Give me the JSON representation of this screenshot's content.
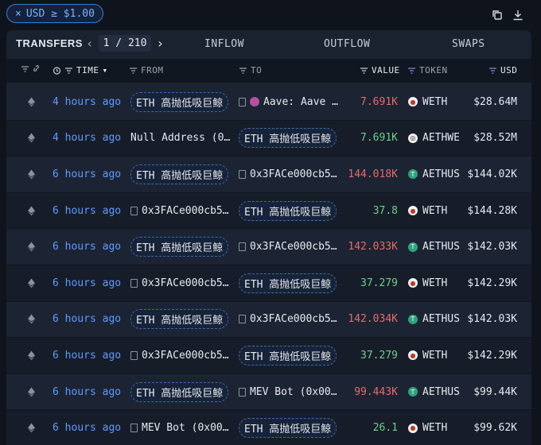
{
  "filter_chip": {
    "close": "×",
    "label": "USD ≥ $1.00"
  },
  "tabs": {
    "active": "TRANSFERS",
    "page": "1 / 210",
    "items": [
      "INFLOW",
      "OUTFLOW",
      "SWAPS"
    ]
  },
  "columns": {
    "time": "TIME",
    "from": "FROM",
    "to": "TO",
    "value": "VALUE",
    "token": "TOKEN",
    "usd": "USD"
  },
  "colors": {
    "accent": "#5f9bff",
    "negative": "#e86a6a",
    "positive": "#6fcf8a",
    "background": "#0f141c"
  },
  "rows": [
    {
      "time": "4 hours ago",
      "from": "ETH 高抛低吸巨鲸",
      "from_kind": "pill",
      "to": "Aave: Aave …",
      "to_kind": "aave",
      "value": "7.691K",
      "value_sign": "neg",
      "token": "WETH",
      "token_kind": "weth",
      "usd": "$28.64M"
    },
    {
      "time": "4 hours ago",
      "from": "Null Address (0…",
      "from_kind": "text",
      "to": "ETH 高抛低吸巨鲸",
      "to_kind": "pill",
      "value": "7.691K",
      "value_sign": "pos",
      "token": "AETHWE",
      "token_kind": "aethwe",
      "usd": "$28.52M"
    },
    {
      "time": "6 hours ago",
      "from": "ETH 高抛低吸巨鲸",
      "from_kind": "pill",
      "to": "0x3FACe000cb5…",
      "to_kind": "doc",
      "value": "144.018K",
      "value_sign": "neg",
      "token": "AETHUS",
      "token_kind": "aethus",
      "usd": "$144.02K"
    },
    {
      "time": "6 hours ago",
      "from": "0x3FACe000cb5…",
      "from_kind": "doc",
      "to": "ETH 高抛低吸巨鲸",
      "to_kind": "pill",
      "value": "37.8",
      "value_sign": "pos",
      "token": "WETH",
      "token_kind": "weth",
      "usd": "$144.28K"
    },
    {
      "time": "6 hours ago",
      "from": "ETH 高抛低吸巨鲸",
      "from_kind": "pill",
      "to": "0x3FACe000cb5…",
      "to_kind": "doc",
      "value": "142.033K",
      "value_sign": "neg",
      "token": "AETHUS",
      "token_kind": "aethus",
      "usd": "$142.03K"
    },
    {
      "time": "6 hours ago",
      "from": "0x3FACe000cb5…",
      "from_kind": "doc",
      "to": "ETH 高抛低吸巨鲸",
      "to_kind": "pill",
      "value": "37.279",
      "value_sign": "pos",
      "token": "WETH",
      "token_kind": "weth",
      "usd": "$142.29K"
    },
    {
      "time": "6 hours ago",
      "from": "ETH 高抛低吸巨鲸",
      "from_kind": "pill",
      "to": "0x3FACe000cb5…",
      "to_kind": "doc",
      "value": "142.034K",
      "value_sign": "neg",
      "token": "AETHUS",
      "token_kind": "aethus",
      "usd": "$142.03K"
    },
    {
      "time": "6 hours ago",
      "from": "0x3FACe000cb5…",
      "from_kind": "doc",
      "to": "ETH 高抛低吸巨鲸",
      "to_kind": "pill",
      "value": "37.279",
      "value_sign": "pos",
      "token": "WETH",
      "token_kind": "weth",
      "usd": "$142.29K"
    },
    {
      "time": "6 hours ago",
      "from": "ETH 高抛低吸巨鲸",
      "from_kind": "pill",
      "to": "MEV Bot (0x00…",
      "to_kind": "doc",
      "value": "99.443K",
      "value_sign": "neg",
      "token": "AETHUS",
      "token_kind": "aethus",
      "usd": "$99.44K"
    },
    {
      "time": "6 hours ago",
      "from": "MEV Bot (0x00…",
      "from_kind": "doc",
      "to": "ETH 高抛低吸巨鲸",
      "to_kind": "pill",
      "value": "26.1",
      "value_sign": "pos",
      "token": "WETH",
      "token_kind": "weth",
      "usd": "$99.62K"
    }
  ]
}
